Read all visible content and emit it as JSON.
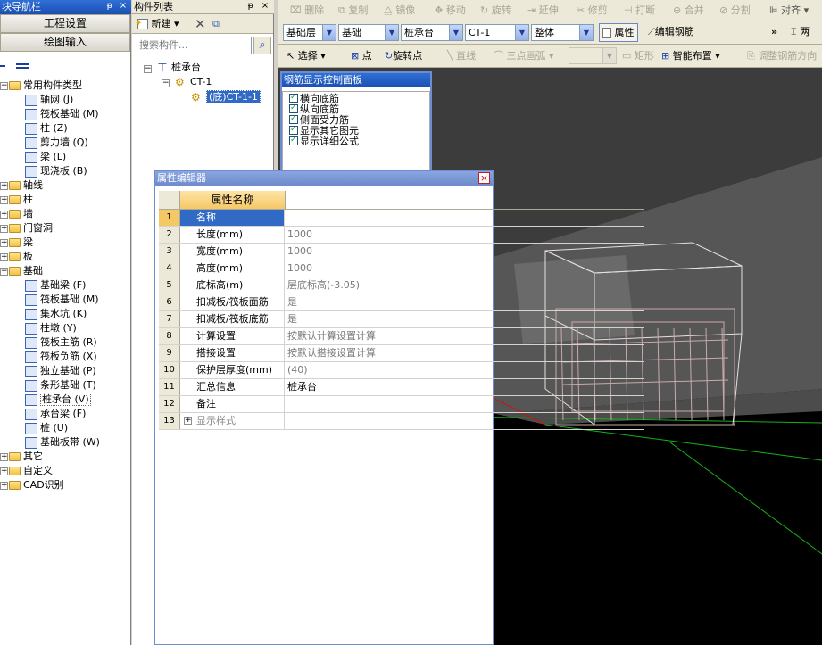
{
  "nav": {
    "title": "块导航栏",
    "pin": "ᵽ",
    "close": "×",
    "btn_project": "工程设置",
    "btn_draw": "绘图输入",
    "tree": [
      {
        "label": "常用构件类型",
        "level": 0,
        "expand": "-"
      },
      {
        "label": "轴网 (J)",
        "level": 1
      },
      {
        "label": "筏板基础 (M)",
        "level": 1
      },
      {
        "label": "柱 (Z)",
        "level": 1
      },
      {
        "label": "剪力墙 (Q)",
        "level": 1
      },
      {
        "label": "梁 (L)",
        "level": 1
      },
      {
        "label": "现浇板 (B)",
        "level": 1
      },
      {
        "label": "轴线",
        "level": 0,
        "expand": "+"
      },
      {
        "label": "柱",
        "level": 0,
        "expand": "+"
      },
      {
        "label": "墙",
        "level": 0,
        "expand": "+"
      },
      {
        "label": "门窗洞",
        "level": 0,
        "expand": "+"
      },
      {
        "label": "梁",
        "level": 0,
        "expand": "+"
      },
      {
        "label": "板",
        "level": 0,
        "expand": "+"
      },
      {
        "label": "基础",
        "level": 0,
        "expand": "-"
      },
      {
        "label": "基础梁 (F)",
        "level": 1
      },
      {
        "label": "筏板基础 (M)",
        "level": 1
      },
      {
        "label": "集水坑 (K)",
        "level": 1
      },
      {
        "label": "柱墩 (Y)",
        "level": 1
      },
      {
        "label": "筏板主筋 (R)",
        "level": 1
      },
      {
        "label": "筏板负筋 (X)",
        "level": 1
      },
      {
        "label": "独立基础 (P)",
        "level": 1
      },
      {
        "label": "条形基础 (T)",
        "level": 1
      },
      {
        "label": "桩承台 (V)",
        "level": 1,
        "selected": true
      },
      {
        "label": "承台梁 (F)",
        "level": 1
      },
      {
        "label": "桩 (U)",
        "level": 1
      },
      {
        "label": "基础板带 (W)",
        "level": 1
      },
      {
        "label": "其它",
        "level": 0,
        "expand": "+"
      },
      {
        "label": "自定义",
        "level": 0,
        "expand": "+"
      },
      {
        "label": "CAD识别",
        "level": 0,
        "expand": "+"
      }
    ]
  },
  "parts": {
    "title": "构件列表",
    "pin": "ᵽ",
    "close": "×",
    "new_label": "新建",
    "search_placeholder": "搜索构件...",
    "tree": {
      "root": "桩承台",
      "child": "CT-1",
      "leaf": "(底)CT-1-1"
    }
  },
  "toolbar1": [
    "删除",
    "复制",
    "镜像",
    "移动",
    "旋转",
    "延伸",
    "修剪",
    "打断",
    "合并",
    "分割",
    "对齐"
  ],
  "toolbar2": {
    "layer": "基础层",
    "type": "基础",
    "member": "桩承台",
    "name": "CT-1",
    "scope": "整体",
    "prop_btn": "属性",
    "edit_rebar": "编辑钢筋",
    "more": "»",
    "two": "两"
  },
  "toolbar3": {
    "select": "选择",
    "point": "点",
    "rotate_point": "旋转点",
    "line": "直线",
    "arc": "三点画弧",
    "rect": "矩形",
    "smart": "智能布置",
    "adjust": "调整钢筋方向"
  },
  "rebar_panel": {
    "title": "钢筋显示控制面板",
    "items": [
      "横向底筋",
      "纵向底筋",
      "侧面受力筋",
      "显示其它图元",
      "显示详细公式"
    ]
  },
  "prop_editor": {
    "title": "属性编辑器",
    "close": "×",
    "col_name": "属性名称",
    "rows": [
      {
        "n": "1",
        "name": "名称",
        "val": ""
      },
      {
        "n": "2",
        "name": "长度(mm)",
        "val": "1000"
      },
      {
        "n": "3",
        "name": "宽度(mm)",
        "val": "1000"
      },
      {
        "n": "4",
        "name": "高度(mm)",
        "val": "1000"
      },
      {
        "n": "5",
        "name": "底标高(m)",
        "val": "层底标高(-3.05)"
      },
      {
        "n": "6",
        "name": "扣减板/筏板面筋",
        "val": "是"
      },
      {
        "n": "7",
        "name": "扣减板/筏板底筋",
        "val": "是"
      },
      {
        "n": "8",
        "name": "计算设置",
        "val": "按默认计算设置计算"
      },
      {
        "n": "9",
        "name": "搭接设置",
        "val": "按默认搭接设置计算"
      },
      {
        "n": "10",
        "name": "保护层厚度(mm)",
        "val": "(40)"
      },
      {
        "n": "11",
        "name": "汇总信息",
        "val": "桩承台"
      },
      {
        "n": "12",
        "name": "备注",
        "val": ""
      },
      {
        "n": "13",
        "name": "显示样式",
        "val": "",
        "expand": "+"
      }
    ]
  }
}
